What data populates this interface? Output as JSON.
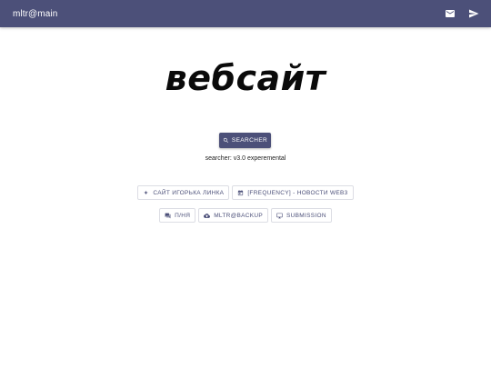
{
  "topbar": {
    "title": "mltr@main",
    "mail_icon": "mail-icon",
    "send_icon": "send-icon",
    "bg_color": "#4c5079"
  },
  "hero": {
    "title": "вебсайт"
  },
  "search": {
    "label": "SEARCHER",
    "icon": "search-icon"
  },
  "version": {
    "text": "searcher: v3.0 experemental"
  },
  "links": [
    {
      "label": "САЙТ ИГОРЬКА ЛИНКА",
      "icon": "sparkle-icon"
    },
    {
      "label": "[FREQUENCY] - НОВОСТИ WEB3",
      "icon": "calendar-icon"
    },
    {
      "label": "П/НЯ",
      "icon": "chat-icon"
    },
    {
      "label": "MLTR@BACKUP",
      "icon": "cloud-upload-icon"
    },
    {
      "label": "SUBMISSION",
      "icon": "monitor-icon"
    }
  ]
}
